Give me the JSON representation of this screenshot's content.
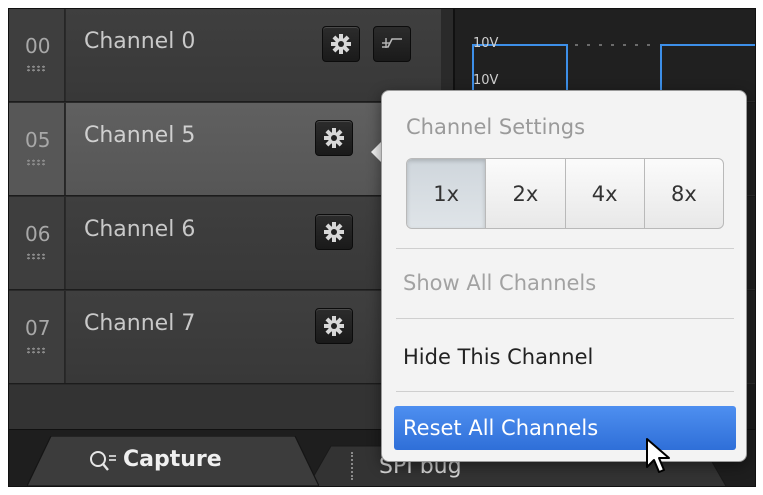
{
  "channels": [
    {
      "num": "00",
      "label": "Channel 0",
      "selected": false
    },
    {
      "num": "05",
      "label": "Channel 5",
      "selected": true
    },
    {
      "num": "06",
      "label": "Channel 6",
      "selected": false
    },
    {
      "num": "07",
      "label": "Channel 7",
      "selected": false
    }
  ],
  "waveform": {
    "scale_label_1": "10V",
    "scale_label_2": "10V",
    "trace_color": "#3d8fe8"
  },
  "bottom_tabs": [
    {
      "label": "Capture",
      "icon": "search-icon",
      "active": true
    },
    {
      "label": "SPI bug",
      "active": false
    }
  ],
  "popover": {
    "title": "Channel Settings",
    "zoom_options": [
      "1x",
      "2x",
      "4x",
      "8x"
    ],
    "zoom_selected": "1x",
    "show_all": "Show All Channels",
    "hide_this": "Hide This Channel",
    "reset_all": "Reset All Channels"
  },
  "colors": {
    "highlight": "#3a7be0",
    "panel_bg": "#3f3f3f",
    "popover_bg": "#f3f3f3"
  }
}
